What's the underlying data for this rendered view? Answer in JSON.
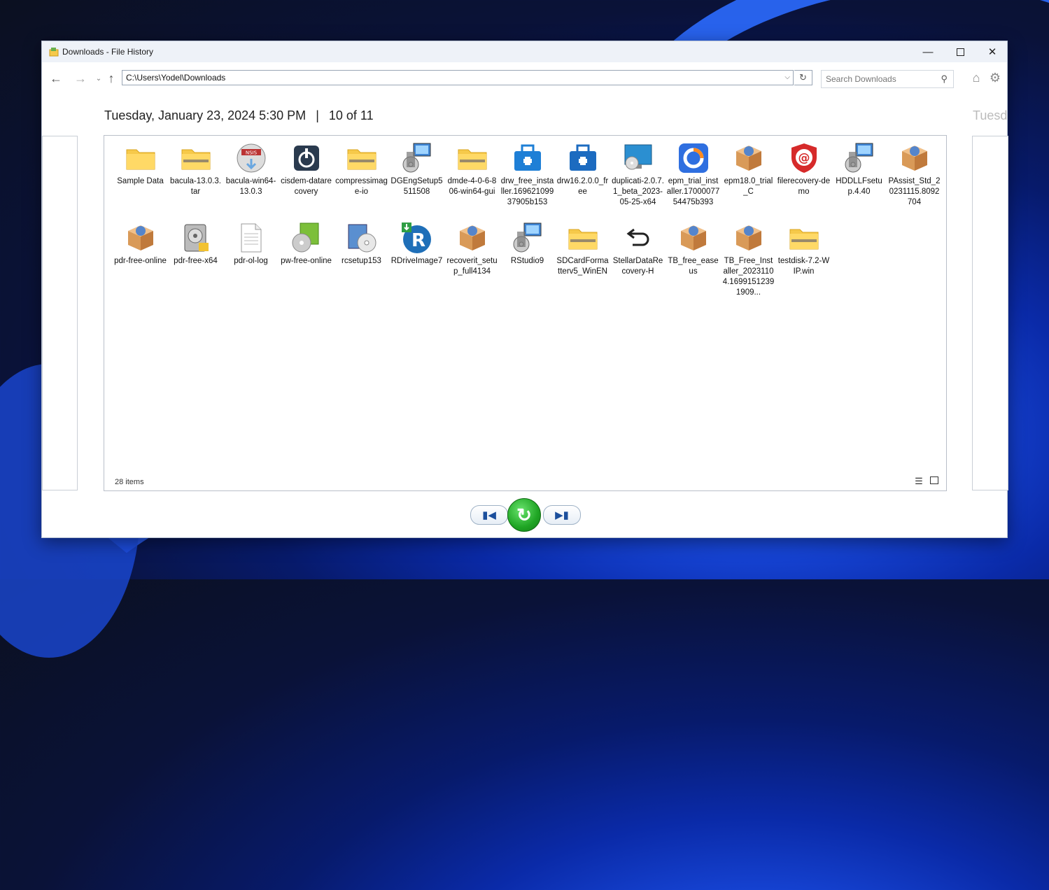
{
  "window": {
    "title": "Downloads - File History"
  },
  "toolbar": {
    "path": "C:\\Users\\Yodel\\Downloads",
    "search_placeholder": "Search Downloads"
  },
  "snapshot": {
    "date": "Tuesday, January 23, 2024 5:30 PM",
    "separator": "|",
    "position": "10 of 11",
    "next_date_partial": "Tuesda"
  },
  "files": [
    {
      "label": "Sample Data",
      "icon": "folder-icon",
      "color": "#f6c94a"
    },
    {
      "label": "bacula-13.0.3.tar",
      "icon": "zip-folder-icon",
      "color": "#f6c94a"
    },
    {
      "label": "bacula-win64-13.0.3",
      "icon": "nsis-installer-icon",
      "color": "#6aa7e0"
    },
    {
      "label": "cisdem-datarecovery",
      "icon": "disk-app-icon",
      "color": "#2a3a4e"
    },
    {
      "label": "compressimage-io",
      "icon": "zip-folder-icon",
      "color": "#f6c94a"
    },
    {
      "label": "DGEngSetup5511508",
      "icon": "setup-computer-icon",
      "color": "#3f86d6"
    },
    {
      "label": "dmde-4-0-6-806-win64-gui",
      "icon": "zip-folder-icon",
      "color": "#f6c94a"
    },
    {
      "label": "drw_free_installer.16962109937905b153",
      "icon": "toolbox-icon",
      "color": "#1e7fd6"
    },
    {
      "label": "drw16.2.0.0_free",
      "icon": "toolbox-icon",
      "color": "#1c6bc0"
    },
    {
      "label": "duplicati-2.0.7.1_beta_2023-05-25-x64",
      "icon": "monitor-disc-icon",
      "color": "#2b8fd1"
    },
    {
      "label": "epm_trial_installer.1700007754475b393",
      "icon": "partition-app-icon",
      "color": "#2f6fe0"
    },
    {
      "label": "epm18.0_trial_C",
      "icon": "package-box-icon",
      "color": "#d99a58"
    },
    {
      "label": "filerecovery-demo",
      "icon": "at-shield-icon",
      "color": "#d62a2a"
    },
    {
      "label": "HDDLLFsetup.4.40",
      "icon": "setup-computer-icon",
      "color": "#3f86d6"
    },
    {
      "label": "PAssist_Std_20231115.8092704",
      "icon": "package-box-icon",
      "color": "#d99a58"
    },
    {
      "label": "pdr-free-online",
      "icon": "package-box-icon",
      "color": "#d99a58"
    },
    {
      "label": "pdr-free-x64",
      "icon": "hdd-app-icon",
      "color": "#555555"
    },
    {
      "label": "pdr-ol-log",
      "icon": "text-file-icon",
      "color": "#ffffff"
    },
    {
      "label": "pw-free-online",
      "icon": "disc-box-icon",
      "color": "#7cbf3a"
    },
    {
      "label": "rcsetup153",
      "icon": "setup-disc-icon",
      "color": "#5a8fd0"
    },
    {
      "label": "RDriveImage7",
      "icon": "r-drive-icon",
      "color": "#1f6fb8"
    },
    {
      "label": "recoverit_setup_full4134",
      "icon": "package-box-icon",
      "color": "#d99a58"
    },
    {
      "label": "RStudio9",
      "icon": "setup-computer-icon",
      "color": "#3f86d6"
    },
    {
      "label": "SDCardFormatterv5_WinEN",
      "icon": "zip-folder-icon",
      "color": "#f6c94a"
    },
    {
      "label": "StellarDataRecovery-H",
      "icon": "shortcut-arrow-icon",
      "color": "#222222"
    },
    {
      "label": "TB_free_easeus",
      "icon": "package-box-icon",
      "color": "#d99a58"
    },
    {
      "label": "TB_Free_Installer_20231104.16991512391909...",
      "icon": "package-box-icon",
      "color": "#d99a58"
    },
    {
      "label": "testdisk-7.2-WIP.win",
      "icon": "zip-folder-icon",
      "color": "#f6c94a"
    }
  ],
  "status": {
    "item_count": "28 items"
  }
}
